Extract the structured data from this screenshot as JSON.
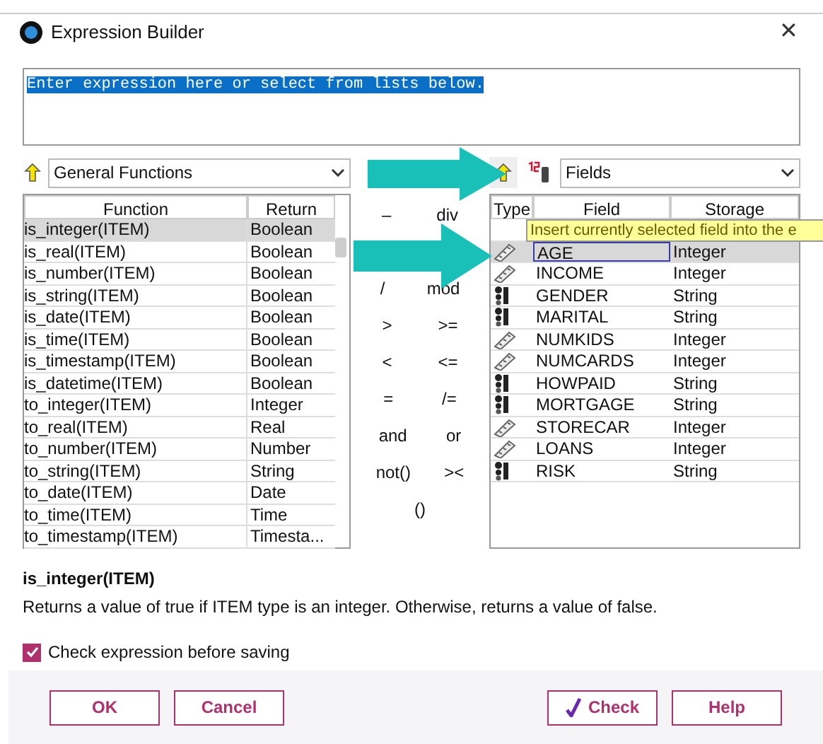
{
  "window": {
    "title": "Expression Builder",
    "close": "✕"
  },
  "expression": {
    "value": "Enter expression here or select from lists below."
  },
  "functions": {
    "category": "General Functions",
    "columns": [
      "Function",
      "Return"
    ],
    "rows": [
      {
        "name": "is_integer(ITEM)",
        "return": "Boolean",
        "selected": true
      },
      {
        "name": "is_real(ITEM)",
        "return": "Boolean",
        "selected": false
      },
      {
        "name": "is_number(ITEM)",
        "return": "Boolean",
        "selected": false
      },
      {
        "name": "is_string(ITEM)",
        "return": "Boolean",
        "selected": false
      },
      {
        "name": "is_date(ITEM)",
        "return": "Boolean",
        "selected": false
      },
      {
        "name": "is_time(ITEM)",
        "return": "Boolean",
        "selected": false
      },
      {
        "name": "is_timestamp(ITEM)",
        "return": "Boolean",
        "selected": false
      },
      {
        "name": "is_datetime(ITEM)",
        "return": "Boolean",
        "selected": false
      },
      {
        "name": "to_integer(ITEM)",
        "return": "Integer",
        "selected": false
      },
      {
        "name": "to_real(ITEM)",
        "return": "Real",
        "selected": false
      },
      {
        "name": "to_number(ITEM)",
        "return": "Number",
        "selected": false
      },
      {
        "name": "to_string(ITEM)",
        "return": "String",
        "selected": false
      },
      {
        "name": "to_date(ITEM)",
        "return": "Date",
        "selected": false
      },
      {
        "name": "to_time(ITEM)",
        "return": "Time",
        "selected": false
      },
      {
        "name": "to_timestamp(ITEM)",
        "return": "Timesta...",
        "selected": false
      }
    ]
  },
  "operators": [
    [
      "–",
      "div"
    ],
    [
      "/",
      "mod"
    ],
    [
      ">",
      ">="
    ],
    [
      "<",
      "<="
    ],
    [
      "=",
      "/="
    ],
    [
      "and",
      "or"
    ],
    [
      "not()",
      "><"
    ],
    [
      "()"
    ]
  ],
  "fields": {
    "category": "Fields",
    "columns": [
      "Type",
      "Field",
      "Storage"
    ],
    "tooltip": "Insert currently selected field into the e",
    "rows": [
      {
        "kind": "continuous",
        "name": "AGE",
        "storage": "Integer",
        "selected": true
      },
      {
        "kind": "continuous",
        "name": "INCOME",
        "storage": "Integer",
        "selected": false
      },
      {
        "kind": "nominal",
        "name": "GENDER",
        "storage": "String",
        "selected": false
      },
      {
        "kind": "nominal",
        "name": "MARITAL",
        "storage": "String",
        "selected": false
      },
      {
        "kind": "continuous",
        "name": "NUMKIDS",
        "storage": "Integer",
        "selected": false
      },
      {
        "kind": "continuous",
        "name": "NUMCARDS",
        "storage": "Integer",
        "selected": false
      },
      {
        "kind": "nominal",
        "name": "HOWPAID",
        "storage": "String",
        "selected": false
      },
      {
        "kind": "nominal",
        "name": "MORTGAGE",
        "storage": "String",
        "selected": false
      },
      {
        "kind": "continuous",
        "name": "STORECAR",
        "storage": "Integer",
        "selected": false
      },
      {
        "kind": "continuous",
        "name": "LOANS",
        "storage": "Integer",
        "selected": false
      },
      {
        "kind": "nominal",
        "name": "RISK",
        "storage": "String",
        "selected": false
      }
    ]
  },
  "description": {
    "title": "is_integer(ITEM)",
    "text": "Returns a value of true if ITEM type is an integer. Otherwise, returns a value of false."
  },
  "check_before_saving": {
    "label": "Check expression before saving",
    "checked": true
  },
  "buttons": [
    {
      "kind": "plain",
      "label": "OK"
    },
    {
      "kind": "plain",
      "label": "Cancel"
    },
    {
      "kind": "check",
      "label": "Check"
    },
    {
      "kind": "plain",
      "label": "Help"
    }
  ]
}
